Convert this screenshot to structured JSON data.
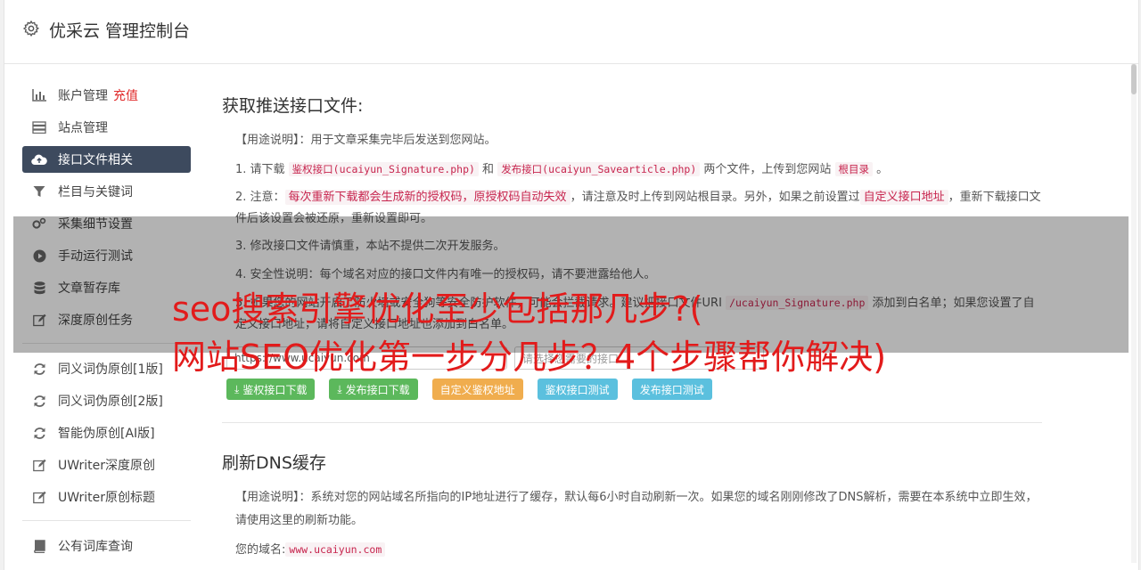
{
  "header": {
    "title": "优采云 管理控制台"
  },
  "sidebar": {
    "items": [
      {
        "label": "账户管理",
        "extra": "充值",
        "icon": "bar-chart-icon"
      },
      {
        "label": "站点管理",
        "icon": "server-icon"
      },
      {
        "label": "接口文件相关",
        "icon": "cloud-upload-icon",
        "active": true
      },
      {
        "label": "栏目与关键词",
        "icon": "filter-icon"
      },
      {
        "label": "采集细节设置",
        "icon": "gears-icon"
      },
      {
        "label": "手动运行测试",
        "icon": "play-circle-icon"
      },
      {
        "label": "文章暂存库",
        "icon": "database-icon"
      },
      {
        "label": "深度原创任务",
        "icon": "edit-icon"
      }
    ],
    "items2": [
      {
        "label": "同义词伪原创[1版]",
        "icon": "refresh-icon"
      },
      {
        "label": "同义词伪原创[2版]",
        "icon": "refresh-icon"
      },
      {
        "label": "智能伪原创[AI版]",
        "icon": "refresh-icon"
      },
      {
        "label": "UWriter深度原创",
        "icon": "edit-icon"
      },
      {
        "label": "UWriter原创标题",
        "icon": "edit-icon"
      }
    ],
    "items3": [
      {
        "label": "公有词库查询",
        "icon": "book-icon"
      }
    ]
  },
  "section1": {
    "title": "获取推送接口文件:",
    "usage_prefix": "【用途说明】：",
    "usage_text": "用于文章采集完毕后发送到您网站。",
    "p1": {
      "a": "1. 请下载 ",
      "code1": "鉴权接口(ucaiyun_Signature.php)",
      "b": " 和 ",
      "code2": "发布接口(ucaiyun_Savearticle.php)",
      "c": " 两个文件，上传到您网站 ",
      "code3": "根目录",
      "d": " 。"
    },
    "p2": {
      "a": "2. 注意：",
      "hl": "每次重新下载都会生成新的授权码，原授权码自动失效",
      "b": "，请注意及时上传到网站根目录。另外，如果之前设置过",
      "hl2": "自定义接口地址",
      "c": "，重新下载接口文件后该设置会被还原，重新设置即可。"
    },
    "p3": "3. 修改接口文件请慎重，本站不提供二次开发服务。",
    "p4": "4. 安全性说明：每个域名对应的接口文件内有唯一的授权码，请不要泄露给他人。",
    "p5": {
      "a": "5. 如果您的网站开启了防火墙或安全狗等安全防护软件，可能会拦截请求。建议把接口文件URI ",
      "code": "/ucaiyun_Signature.php",
      "b": " 添加到白名单；如果您设置了自定义接口地址，请将自定义接口地址也添加到白名单。"
    },
    "domain_value": "https://www.ucaiyun.com",
    "select_placeholder": "请选择您需要的接口",
    "buttons": {
      "sig_download": "鉴权接口下载",
      "pub_download": "发布接口下载",
      "custom": "自定义鉴权地址",
      "sig_test": "鉴权接口测试",
      "pub_test": "发布接口测试"
    }
  },
  "section2": {
    "title": "刷新DNS缓存",
    "usage_prefix": "【用途说明】：",
    "usage_text": "系统对您的网站域名所指向的IP地址进行了缓存，默认每6小时自动刷新一次。如果您的域名刚刚修改了DNS解析，需要在本系统中立即生效，请使用这里的刷新功能。",
    "domain_label": "您的域名:",
    "domain_value": "www.ucaiyun.com"
  },
  "overlay": {
    "line1": "seo搜索引擎优化至少包括那几步?(",
    "line2": "网站SEO优化第一步分几步？4个步骤帮你解决)"
  }
}
